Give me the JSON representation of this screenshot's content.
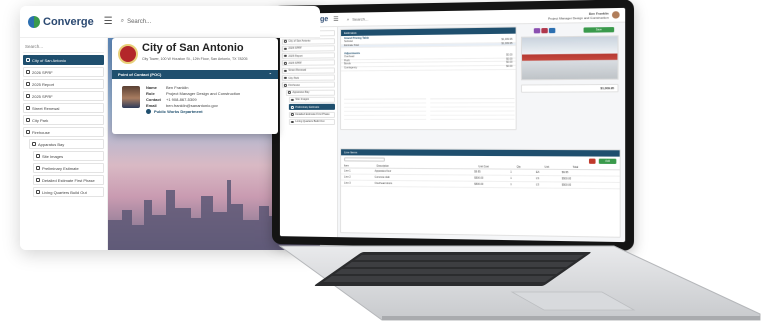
{
  "brand": {
    "name": "Converge",
    "primary": "#1f4f6e",
    "green": "#3a9a4c"
  },
  "back_window": {
    "search_placeholder": "Search...",
    "sidebar_search": "Search...",
    "sidebar_items": [
      {
        "label": "City of San Antonio",
        "active": true
      },
      {
        "label": "2026 SPRF",
        "active": false
      },
      {
        "label": "2025 Report",
        "active": false
      },
      {
        "label": "2025 SPRF",
        "active": false
      },
      {
        "label": "Street Renewal",
        "active": false
      },
      {
        "label": "City Park",
        "active": false
      },
      {
        "label": "Firehouse",
        "active": false
      },
      {
        "label": "Apparatus Bay",
        "active": false
      },
      {
        "label": "Site Images",
        "active": false
      },
      {
        "label": "Preliminary Estimate",
        "active": false
      },
      {
        "label": "Detailed Estimate First Phase",
        "active": false
      },
      {
        "label": "Living Quarters Build Out",
        "active": false
      }
    ],
    "city_card": {
      "title": "City of San Antonio",
      "address": "City Tower, 100 W Houston St., 12th Floor, San Antonio, TX 78205",
      "poc_label": "Point of Contact (POC)",
      "rows": [
        {
          "key": "Name",
          "value": "Ben Franklin"
        },
        {
          "key": "Role",
          "value": "Project Manager Design and Construction"
        },
        {
          "key": "Contact",
          "value": "+1 908-867-5309"
        },
        {
          "key": "Email",
          "value": "ben.franklin@sanantonio.gov"
        }
      ],
      "department": "Public Works Department"
    }
  },
  "laptop": {
    "search_placeholder": "Search...",
    "user_name": "Ben Franklin",
    "user_role": "Project Manager Design and Construction",
    "sidebar_items": [
      {
        "label": "Search...",
        "active": false
      },
      {
        "label": "City of San Antonio",
        "active": false
      },
      {
        "label": "2026 SPRF",
        "active": false
      },
      {
        "label": "2025 Report",
        "active": false
      },
      {
        "label": "2025 SPRF",
        "active": false
      },
      {
        "label": "Street Renewal",
        "active": false
      },
      {
        "label": "City Park",
        "active": false
      },
      {
        "label": "Firehouse",
        "active": false
      },
      {
        "label": "Apparatus Bay",
        "active": false
      },
      {
        "label": "Site Images",
        "active": false
      },
      {
        "label": "Preliminary Estimate",
        "active": true
      },
      {
        "label": "Detailed Estimate First Phase",
        "active": false
      },
      {
        "label": "Living Quarters Build Out",
        "active": false
      }
    ],
    "estimate_panel_title": "Estimates",
    "estimate_section": "Grand Pricing Table",
    "estimate_rows": [
      {
        "label": "Subtotal",
        "value": "$1,009.95"
      },
      {
        "label": "Estimate Total",
        "value": "$1,009.95"
      }
    ],
    "adjustments_section": "Adjustments",
    "adjustment_rows": [
      {
        "label": "Overhead",
        "value": "$0.00"
      },
      {
        "label": "Profit",
        "value": "$0.00"
      },
      {
        "label": "Bonds",
        "value": "$0.00"
      },
      {
        "label": "Contingency",
        "value": "$0.00"
      }
    ],
    "summary_value": "$1,009.95",
    "line_items_title": "Line Items",
    "table_headers": [
      "Item",
      "Description",
      "Unit Cost",
      "Qty",
      "Unit",
      "Total"
    ],
    "table_rows": [
      {
        "item": "Line 1",
        "desc": "Apparatus floor",
        "cost": "$9.95",
        "qty": "1",
        "unit": "EA",
        "total": "$9.95"
      },
      {
        "item": "Line 2",
        "desc": "Concrete slab",
        "cost": "$500.00",
        "qty": "1",
        "unit": "LS",
        "total": "$500.00"
      },
      {
        "item": "Line 3",
        "desc": "Overhead doors",
        "cost": "$500.00",
        "qty": "1",
        "unit": "LS",
        "total": "$500.00"
      }
    ],
    "add_button": "Add",
    "save_button": "Save"
  }
}
